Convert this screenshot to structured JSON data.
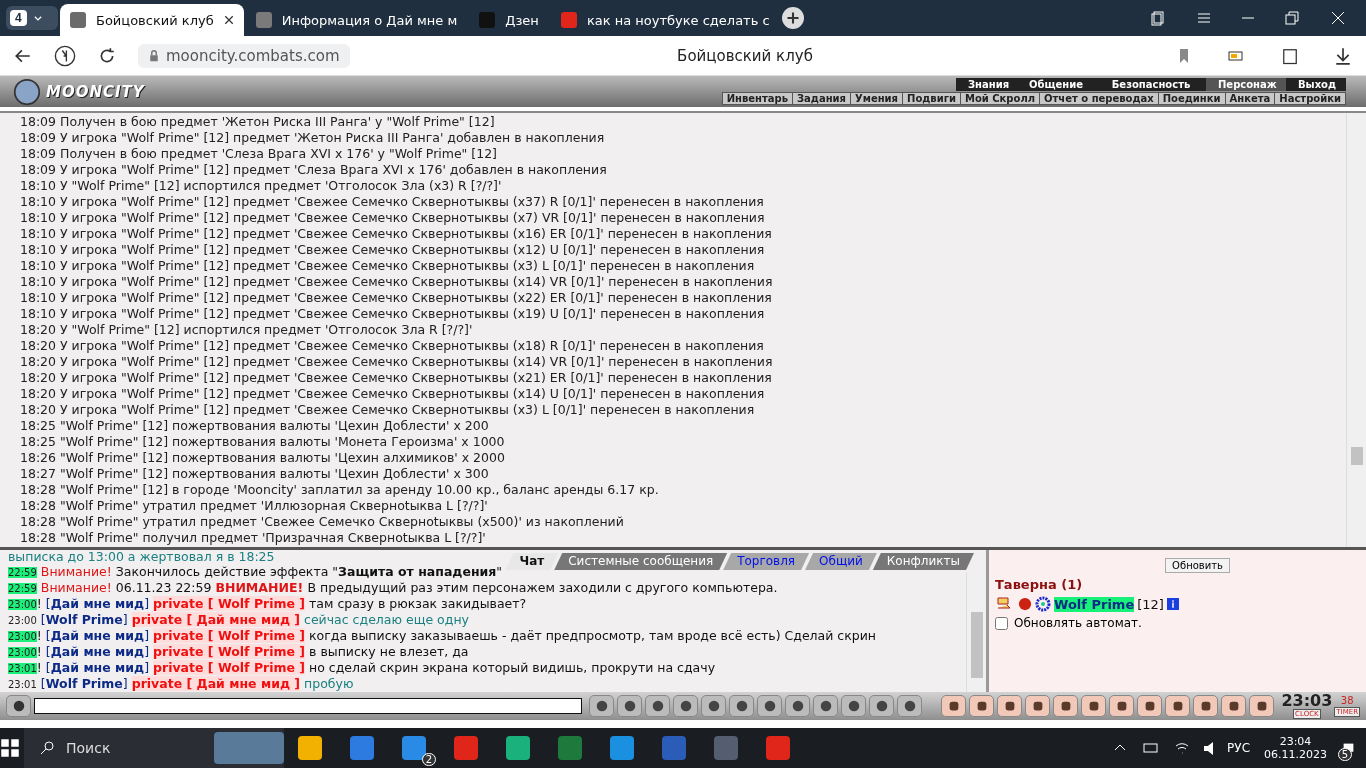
{
  "browser": {
    "tab_count": "4",
    "tabs": [
      {
        "title": "Бойцовский клуб",
        "selected": true,
        "color": "#6b6b6b"
      },
      {
        "title": "Информация о Дай мне м",
        "selected": false,
        "color": "#7a7a7a"
      },
      {
        "title": "Дзен",
        "selected": false,
        "color": "#111111"
      },
      {
        "title": "как на ноутбуке сделать с",
        "selected": false,
        "color": "#e0261b"
      }
    ],
    "url": "mooncity.combats.com",
    "page_title": "Бойцовский клуб"
  },
  "game": {
    "logo": "MOONCITY",
    "top_menu": [
      {
        "label": "Знания",
        "selected": false
      },
      {
        "label": "Общение",
        "selected": false
      },
      {
        "label": "Безопасность",
        "selected": false
      },
      {
        "label": "Персонаж",
        "selected": true
      },
      {
        "label": "Выход",
        "selected": false
      }
    ],
    "sub_menu": [
      "Инвентарь",
      "Задания",
      "Умения",
      "Подвиги",
      "Мой Скролл",
      "Отчет о переводах",
      "Поединки",
      "Анкета",
      "Настройки"
    ],
    "log": [
      "18:09 Получен в бою предмет 'Жетон Риска III Ранга' у \"Wolf Prime\" [12]",
      "18:09 У игрока \"Wolf Prime\" [12] предмет 'Жетон Риска III Ранга' добавлен в накопления",
      "18:09 Получен в бою предмет 'Слеза Врага XVI x 176' у \"Wolf Prime\" [12]",
      "18:09 У игрока \"Wolf Prime\" [12] предмет 'Слеза Врага XVI x 176' добавлен в накопления",
      "18:10 У \"Wolf Prime\" [12] испортился предмет 'Отголосок Зла (x3) R [?/?]'",
      "18:10 У игрока \"Wolf Prime\" [12] предмет 'Свежее Семечко Сквернотыквы (x37) R [0/1]' перенесен в накопления",
      "18:10 У игрока \"Wolf Prime\" [12] предмет 'Свежее Семечко Сквернотыквы (x7) VR [0/1]' перенесен в накопления",
      "18:10 У игрока \"Wolf Prime\" [12] предмет 'Свежее Семечко Сквернотыквы (x16) ER [0/1]' перенесен в накопления",
      "18:10 У игрока \"Wolf Prime\" [12] предмет 'Свежее Семечко Сквернотыквы (x12) U [0/1]' перенесен в накопления",
      "18:10 У игрока \"Wolf Prime\" [12] предмет 'Свежее Семечко Сквернотыквы (x3) L [0/1]' перенесен в накопления",
      "18:10 У игрока \"Wolf Prime\" [12] предмет 'Свежее Семечко Сквернотыквы (x14) VR [0/1]' перенесен в накопления",
      "18:10 У игрока \"Wolf Prime\" [12] предмет 'Свежее Семечко Сквернотыквы (x22) ER [0/1]' перенесен в накопления",
      "18:10 У игрока \"Wolf Prime\" [12] предмет 'Свежее Семечко Сквернотыквы (x19) U [0/1]' перенесен в накопления",
      "18:20 У \"Wolf Prime\" [12] испортился предмет 'Отголосок Зла R [?/?]'",
      "18:20 У игрока \"Wolf Prime\" [12] предмет 'Свежее Семечко Сквернотыквы (x18) R [0/1]' перенесен в накопления",
      "18:20 У игрока \"Wolf Prime\" [12] предмет 'Свежее Семечко Сквернотыквы (x14) VR [0/1]' перенесен в накопления",
      "18:20 У игрока \"Wolf Prime\" [12] предмет 'Свежее Семечко Сквернотыквы (x21) ER [0/1]' перенесен в накопления",
      "18:20 У игрока \"Wolf Prime\" [12] предмет 'Свежее Семечко Сквернотыквы (x14) U [0/1]' перенесен в накопления",
      "18:20 У игрока \"Wolf Prime\" [12] предмет 'Свежее Семечко Сквернотыквы (x3) L [0/1]' перенесен в накопления",
      "18:25 \"Wolf Prime\" [12] пожертвования валюты 'Цехин Доблести' x 200",
      "18:25 \"Wolf Prime\" [12] пожертвования валюты 'Монета Героизма' x 1000",
      "18:26 \"Wolf Prime\" [12] пожертвования валюты 'Цехин алхимиков' x 2000",
      "18:27 \"Wolf Prime\" [12] пожертвования валюты 'Цехин Доблести' x 300",
      "18:28 \"Wolf Prime\" [12] в городе 'Mooncity' заплатил за аренду 10.00 кр., баланс аренды 6.17 кр.",
      "18:28 \"Wolf Prime\" утратил предмет 'Иллюзорная Скверноtыква L [?/?]'",
      "18:28 \"Wolf Prime\" утратил предмет 'Свежее Семечко Скверноtыквы (x500)' из накоплений",
      "18:28 \"Wolf Prime\" получил предмет 'Призрачная Скверноtыква L [?/?]'"
    ],
    "chat_cut_line": "выписка до 13:00 а жертвовал я в 18:25",
    "chat_tabs": [
      {
        "label": "Чат",
        "selected": true
      },
      {
        "label": "Системные сообщения",
        "selected": false
      },
      {
        "label": "Торговля",
        "selected": false
      },
      {
        "label": "Общий",
        "selected": false
      },
      {
        "label": "Конфликты",
        "selected": false
      }
    ],
    "chat": [
      {
        "kind": "warning",
        "time": "22:59",
        "highlight": true,
        "label": "Внимание!",
        "text": "Закончилось действие эффекта \"**Защита от нападения**\""
      },
      {
        "kind": "warning",
        "time": "22:59",
        "highlight": true,
        "label": "Внимание!",
        "date": "06.11.23 22:59",
        "alert": "ВНИМАНИЕ!",
        "text": "В предыдущий раз этим персонажем заходили с другого компьютера."
      },
      {
        "kind": "private",
        "time": "23:00",
        "highlight": true,
        "mark": "!",
        "sender": "[**Дай мне мид**]",
        "target": "private [ Wolf Prime ]",
        "text": "там сразу в рюкзак закидывает?",
        "own": false
      },
      {
        "kind": "private",
        "time": "23:00",
        "highlight": false,
        "sender": "[**Wolf Prime**]",
        "target": "private [ Дай мне мид ]",
        "text": "сейчас сделаю еще одну",
        "own": true
      },
      {
        "kind": "private",
        "time": "23:00",
        "highlight": true,
        "mark": "!",
        "sender": "[**Дай мне мид**]",
        "target": "private [ Wolf Prime ]",
        "text": "когда выписку заказываешь - даёт предпросмотр, там вроде всё есть) Сделай скрин",
        "own": false
      },
      {
        "kind": "private",
        "time": "23:00",
        "highlight": true,
        "mark": "!",
        "sender": "[**Дай мне мид**]",
        "target": "private [ Wolf Prime ]",
        "text": "в выписку не влезет, да",
        "own": false
      },
      {
        "kind": "private",
        "time": "23:01",
        "highlight": true,
        "mark": "!",
        "sender": "[**Дай мне мид**]",
        "target": "private [ Wolf Prime ]",
        "text": "но сделай скрин экрана который видишь, прокрути на сдачу",
        "own": false
      },
      {
        "kind": "private",
        "time": "23:01",
        "highlight": false,
        "sender": "[**Wolf Prime**]",
        "target": "private [ Дай мне мид ]",
        "text": "пробую",
        "own": true
      }
    ],
    "room": {
      "refresh_button": "Обновить",
      "title": "Таверна (1)",
      "player": {
        "name": "Wolf Prime",
        "level": "[12]"
      },
      "auto_refresh": {
        "label": "Обновлять автомат.",
        "checked": false
      }
    },
    "clock": {
      "time": "23:03",
      "seconds": "38",
      "clock_label": "CLOCK",
      "timer_label": "TIMER"
    }
  },
  "taskbar": {
    "search": "Поиск",
    "mail_badge": "2",
    "lang": "РУС",
    "time": "23:04",
    "date": "06.11.2023",
    "notifications": "5"
  }
}
